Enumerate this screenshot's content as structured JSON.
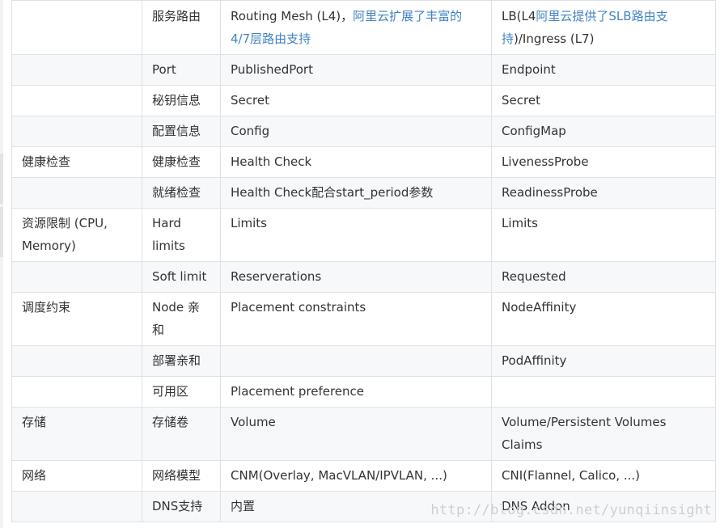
{
  "rows": [
    {
      "c1": "",
      "c2": "服务路由",
      "c3a": "Routing Mesh (L4)，",
      "c3link": "阿里云扩展了丰富的4/7层路由支持",
      "c4a": "LB(L4",
      "c4link": "阿里云提供了SLB路由支持",
      "c4b": ")/Ingress (L7)"
    },
    {
      "c1": "",
      "c2": "Port",
      "c3": "PublishedPort",
      "c4": "Endpoint"
    },
    {
      "c1": "",
      "c2": "秘钥信息",
      "c3": "Secret",
      "c4": "Secret"
    },
    {
      "c1": "",
      "c2": "配置信息",
      "c3": "Config",
      "c4": "ConfigMap"
    },
    {
      "c1": "健康检查",
      "c2": "健康检查",
      "c3": "Health Check",
      "c4": "LivenessProbe"
    },
    {
      "c1": "",
      "c2": "就绪检查",
      "c3": "Health Check配合start_period参数",
      "c4": "ReadinessProbe"
    },
    {
      "c1": "资源限制 (CPU, Memory)",
      "c2": "Hard limits",
      "c3": "Limits",
      "c4": "Limits"
    },
    {
      "c1": "",
      "c2": "Soft limit",
      "c3": "Reserverations",
      "c4": "Requested"
    },
    {
      "c1": "调度约束",
      "c2": "Node 亲和",
      "c3": "Placement constraints",
      "c4": "NodeAffinity"
    },
    {
      "c1": "",
      "c2": "部署亲和",
      "c3": "",
      "c4": "PodAffinity"
    },
    {
      "c1": "",
      "c2": "可用区",
      "c3": "Placement preference",
      "c4": ""
    },
    {
      "c1": "存储",
      "c2": "存储卷",
      "c3": "Volume",
      "c4": "Volume/Persistent Volumes Claims"
    },
    {
      "c1": "网络",
      "c2": "网络模型",
      "c3": "CNM(Overlay, MacVLAN/IPVLAN, ...)",
      "c4": "CNI(Flannel, Calico, ...)"
    },
    {
      "c1": "",
      "c2": "DNS支持",
      "c3": "内置",
      "c4": "DNS Addon"
    }
  ],
  "watermark": "http://blog.csdn.net/yunqiinsight"
}
